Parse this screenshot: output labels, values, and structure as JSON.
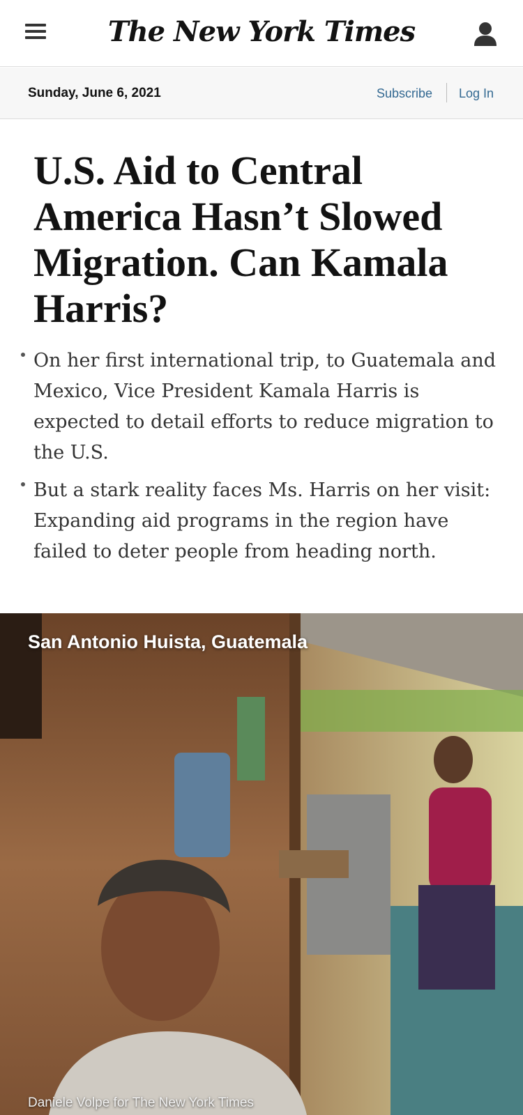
{
  "header": {
    "logo_text": "The New York Times",
    "menu_icon": "hamburger-menu-icon",
    "account_icon": "user-account-icon"
  },
  "datebar": {
    "date": "Sunday, June 6, 2021",
    "subscribe_label": "Subscribe",
    "login_label": "Log In"
  },
  "article": {
    "headline": "U.S. Aid to Central America Hasn’t Slowed Migration. Can Kamala Harris?",
    "summary": [
      "On her first international trip, to Guatemala and Mexico, Vice President Kamala Harris is expected to detail efforts to reduce migration to the U.S.",
      "But a stark reality faces Ms. Harris on her visit: Expanding aid programs in the region have failed to deter people from heading north."
    ]
  },
  "lead_image": {
    "location": "San Antonio Huista, Guatemala",
    "credit": "Daniele Volpe for The New York Times"
  },
  "colors": {
    "link": "#326891",
    "text": "#121212",
    "datebar_bg": "#f7f7f7"
  }
}
